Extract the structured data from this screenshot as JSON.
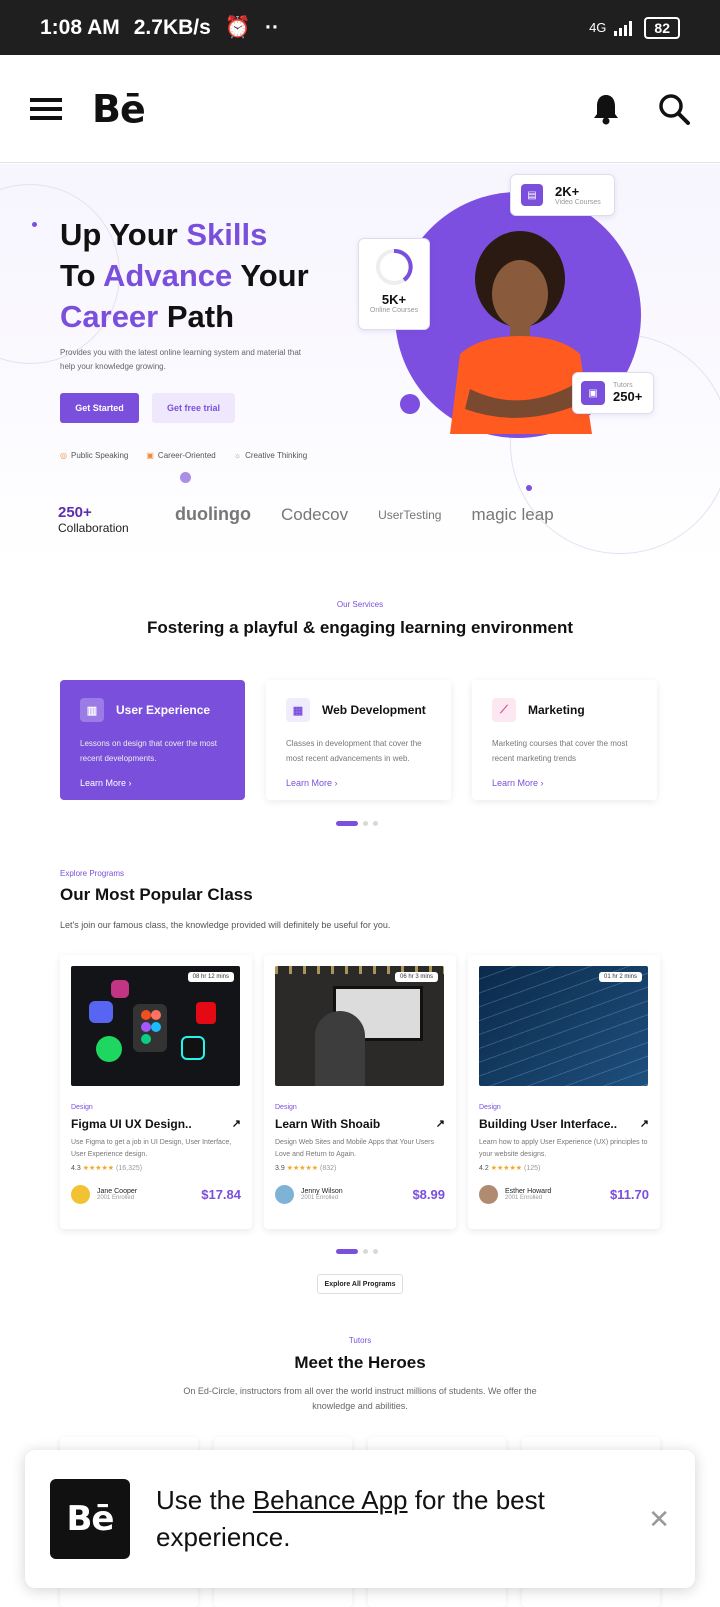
{
  "status_bar": {
    "time": "1:08 AM",
    "speed": "2.7KB/s",
    "network": "4G",
    "battery": "82"
  },
  "app": {
    "logo": "Bē"
  },
  "hero": {
    "title_parts": [
      "Up Your ",
      "Skills",
      "To ",
      "Advance",
      " Your",
      "Career",
      " Path"
    ],
    "description": "Provides you with the latest online learning system and material that help your knowledge growing.",
    "btn_get_started": "Get Started",
    "btn_free_trial": "Get free trial",
    "features": [
      "Public Speaking",
      "Career-Oriented",
      "Creative Thinking"
    ],
    "stat_video_num": "2K+",
    "stat_video_label": "Video Courses",
    "stat_online_num": "5K+",
    "stat_online_label": "Online Courses",
    "stat_tutors_label": "Tutors",
    "stat_tutors_num": "250+",
    "collab_num": "250+",
    "collab_label": "Collaboration",
    "brands": [
      "duolingo",
      "Codecov",
      "UserTesting",
      "magic leap"
    ]
  },
  "services": {
    "kicker": "Our Services",
    "title": "Fostering a playful & engaging learning environment",
    "cards": [
      {
        "title": "User Experience",
        "body": "Lessons on design that cover the most recent developments.",
        "more": "Learn More  ›"
      },
      {
        "title": "Web Development",
        "body": "Classes in development that cover the most recent advancements in web.",
        "more": "Learn More  ›"
      },
      {
        "title": "Marketing",
        "body": "Marketing courses that cover the most recent marketing trends",
        "more": "Learn More  ›"
      }
    ]
  },
  "programs": {
    "kicker": "Explore Programs",
    "title": "Our Most Popular Class",
    "description": "Let's join our famous class, the knowledge provided will definitely be useful for you.",
    "classes": [
      {
        "duration": "08 hr 12 mins",
        "category": "Design",
        "name": "Figma UI UX Design..",
        "desc": "Use Figma to get a job in UI Design, User Interface, User Experience design.",
        "rating": "4.3",
        "count": "(16,325)",
        "tutor": "Jane Cooper",
        "enrolled": "2001 Enrolled",
        "price": "$17.84"
      },
      {
        "duration": "06 hr 3 mins",
        "category": "Design",
        "name": "Learn With Shoaib",
        "desc": "Design Web Sites and Mobile Apps that Your Users Love and Return to Again.",
        "rating": "3.9",
        "count": "(832)",
        "tutor": "Jenny Wilson",
        "enrolled": "2001 Enrolled",
        "price": "$8.99"
      },
      {
        "duration": "01 hr 2 mins",
        "category": "Design",
        "name": "Building User Interface..",
        "desc": "Learn how to apply User Experience (UX) principles to your website designs.",
        "rating": "4.2",
        "count": "(125)",
        "tutor": "Esther Howard",
        "enrolled": "2001 Enrolled",
        "price": "$11.70"
      }
    ],
    "explore_btn": "Explore All Programs"
  },
  "tutors": {
    "kicker": "Tutors",
    "title": "Meet the Heroes",
    "description": "On Ed-Circle, instructors from all over the world instruct millions of students. We offer the knowledge and abilities."
  },
  "banner": {
    "logo": "Bē",
    "text_before": "Use the ",
    "link": "Behance App",
    "text_after": " for the best experience.",
    "close": "✕"
  },
  "colors": {
    "accent": "#7a4fdc",
    "dark": "#1f1f1f"
  }
}
